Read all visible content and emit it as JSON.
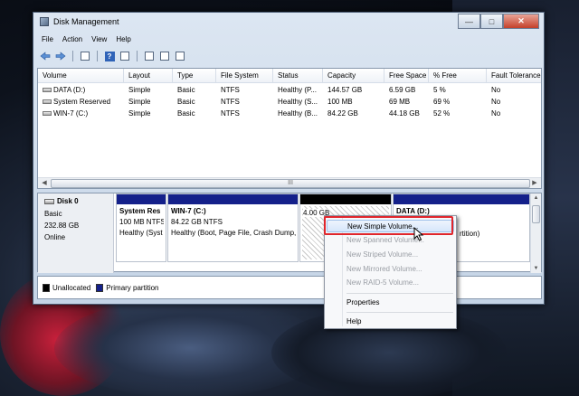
{
  "window": {
    "title": "Disk Management",
    "controls": {
      "minimize": "—",
      "maximize": "□",
      "close": "✕"
    }
  },
  "menu": [
    "File",
    "Action",
    "View",
    "Help"
  ],
  "toolbar": {
    "back_icon": "arrow-left-icon",
    "forward_icon": "arrow-right-icon",
    "help_glyph": "?"
  },
  "volume_list": {
    "columns": [
      "Volume",
      "Layout",
      "Type",
      "File System",
      "Status",
      "Capacity",
      "Free Space",
      "% Free",
      "Fault Tolerance"
    ],
    "rows": [
      [
        "DATA (D:)",
        "Simple",
        "Basic",
        "NTFS",
        "Healthy (P...",
        "144.57 GB",
        "6.59 GB",
        "5 %",
        "No"
      ],
      [
        "System Reserved",
        "Simple",
        "Basic",
        "NTFS",
        "Healthy (S...",
        "100 MB",
        "69 MB",
        "69 %",
        "No"
      ],
      [
        "WIN-7 (C:)",
        "Simple",
        "Basic",
        "NTFS",
        "Healthy (B...",
        "84.22 GB",
        "44.18 GB",
        "52 %",
        "No"
      ]
    ],
    "scroll_grip": "III"
  },
  "disk": {
    "name": "Disk 0",
    "type": "Basic",
    "size": "232.88 GB",
    "status": "Online",
    "partitions": [
      {
        "title": "System Res",
        "line1": "100 MB NTFS",
        "line2": "Healthy (Syst"
      },
      {
        "title": "WIN-7  (C:)",
        "line1": "84.22 GB NTFS",
        "line2": "Healthy (Boot, Page File, Crash Dump,"
      },
      {
        "line1": "4.00 GB"
      },
      {
        "title": "DATA  (D:)",
        "line2": "rtition)"
      }
    ]
  },
  "legend": {
    "unallocated": "Unallocated",
    "primary": "Primary partition",
    "colors": {
      "unallocated": "#000000",
      "primary": "#14208a"
    }
  },
  "context_menu": {
    "items": [
      {
        "label": "New Simple Volume...",
        "enabled": true,
        "highlighted": true
      },
      {
        "label": "New Spanned Volume...",
        "enabled": false
      },
      {
        "label": "New Striped Volume...",
        "enabled": false
      },
      {
        "label": "New Mirrored Volume...",
        "enabled": false
      },
      {
        "label": "New RAID-5 Volume...",
        "enabled": false
      },
      {
        "label": "Properties",
        "enabled": true
      },
      {
        "label": "Help",
        "enabled": true
      }
    ],
    "highlight_color": "#e0262c"
  }
}
